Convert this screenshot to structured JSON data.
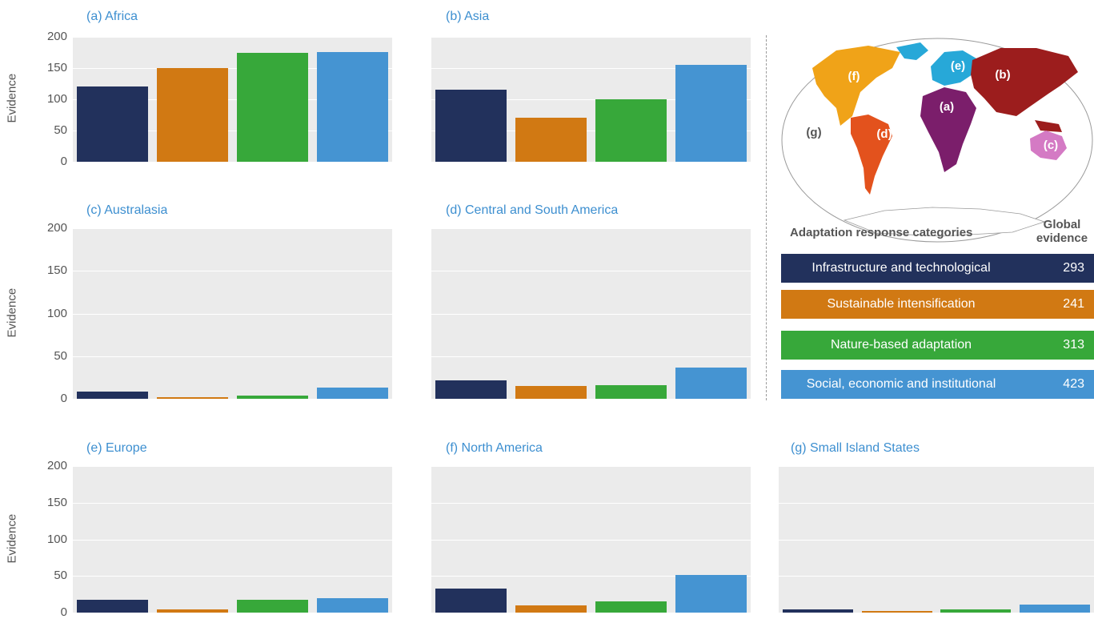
{
  "categories": [
    {
      "name": "Infrastructure and technological",
      "color": "#22315c",
      "global": "293"
    },
    {
      "name": "Sustainable intensification",
      "color": "#d17913",
      "global": "241"
    },
    {
      "name": "Nature-based adaptation",
      "color": "#37a83a",
      "global": "313"
    },
    {
      "name": "Social, economic and institutional",
      "color": "#4594d2",
      "global": "423"
    }
  ],
  "legend": {
    "header": "Adaptation response categories",
    "global_header": "Global evidence"
  },
  "ylabel": "Evidence",
  "yticks": [
    "0",
    "50",
    "100",
    "150",
    "200"
  ],
  "map": {
    "labels": [
      "(a)",
      "(b)",
      "(c)",
      "(d)",
      "(e)",
      "(f)",
      "(g)"
    ],
    "colors": {
      "a": "#7b1e6b",
      "b": "#9c1d1d",
      "c": "#d47ac4",
      "d": "#e3521d",
      "e": "#27a8d8",
      "f": "#f0a318"
    }
  },
  "chart_data": [
    {
      "type": "bar",
      "title": "(a) Africa",
      "categories": [
        "Infrastructure and technological",
        "Sustainable intensification",
        "Nature-based adaptation",
        "Social, economic and institutional"
      ],
      "values": [
        120,
        150,
        175,
        176
      ],
      "ylabel": "Evidence",
      "ylim": [
        0,
        200
      ]
    },
    {
      "type": "bar",
      "title": "(b) Asia",
      "categories": [
        "Infrastructure and technological",
        "Sustainable intensification",
        "Nature-based adaptation",
        "Social, economic and institutional"
      ],
      "values": [
        115,
        71,
        100,
        155
      ],
      "ylabel": "",
      "ylim": [
        0,
        200
      ]
    },
    {
      "type": "bar",
      "title": "(c) Australasia",
      "categories": [
        "Infrastructure and technological",
        "Sustainable intensification",
        "Nature-based adaptation",
        "Social, economic and institutional"
      ],
      "values": [
        8,
        2,
        4,
        13
      ],
      "ylabel": "Evidence",
      "ylim": [
        0,
        200
      ]
    },
    {
      "type": "bar",
      "title": "(d) Central and South America",
      "categories": [
        "Infrastructure and technological",
        "Sustainable intensification",
        "Nature-based adaptation",
        "Social, economic and institutional"
      ],
      "values": [
        22,
        15,
        16,
        37
      ],
      "ylabel": "",
      "ylim": [
        0,
        200
      ]
    },
    {
      "type": "bar",
      "title": "(e) Europe",
      "categories": [
        "Infrastructure and technological",
        "Sustainable intensification",
        "Nature-based adaptation",
        "Social, economic and institutional"
      ],
      "values": [
        17,
        4,
        17,
        20
      ],
      "ylabel": "Evidence",
      "ylim": [
        0,
        200
      ]
    },
    {
      "type": "bar",
      "title": "(f) North America",
      "categories": [
        "Infrastructure and technological",
        "Sustainable intensification",
        "Nature-based adaptation",
        "Social, economic and institutional"
      ],
      "values": [
        33,
        10,
        15,
        51
      ],
      "ylabel": "",
      "ylim": [
        0,
        200
      ]
    },
    {
      "type": "bar",
      "title": "(g) Small Island States",
      "categories": [
        "Infrastructure and technological",
        "Sustainable intensification",
        "Nature-based adaptation",
        "Social, economic and institutional"
      ],
      "values": [
        4,
        2,
        4,
        11
      ],
      "ylabel": "",
      "ylim": [
        0,
        200
      ]
    }
  ]
}
